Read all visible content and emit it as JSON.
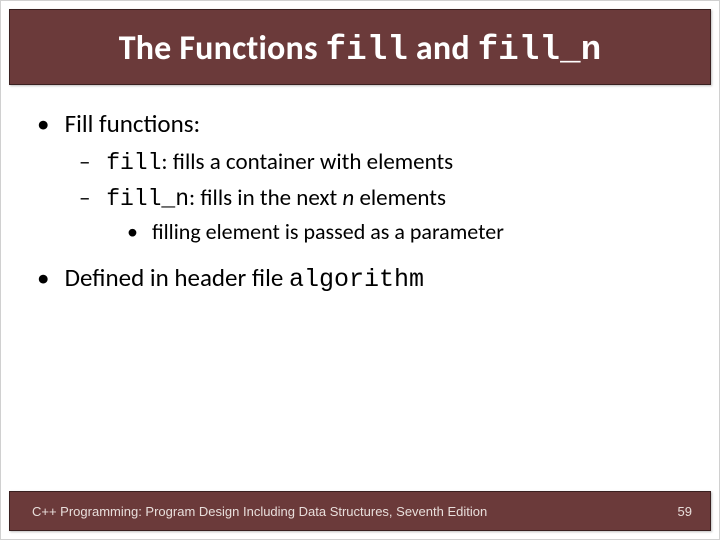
{
  "title": {
    "prefix": "The Functions ",
    "code1": "fill",
    "mid": " and ",
    "code2": "fill_n"
  },
  "bullets": {
    "b1": "Fill functions:",
    "b1a_code": "fill",
    "b1a_text": ": fills a container with elements",
    "b1b_code": "fill_n",
    "b1b_text_pre": ": fills in the next ",
    "b1b_n": "n",
    "b1b_text_post": " elements",
    "b1b_i": "filling element is passed as a parameter",
    "b2_pre": "Defined in header file ",
    "b2_code": "algorithm"
  },
  "footer": {
    "text": "C++ Programming: Program Design Including Data Structures, Seventh Edition",
    "page": "59"
  }
}
